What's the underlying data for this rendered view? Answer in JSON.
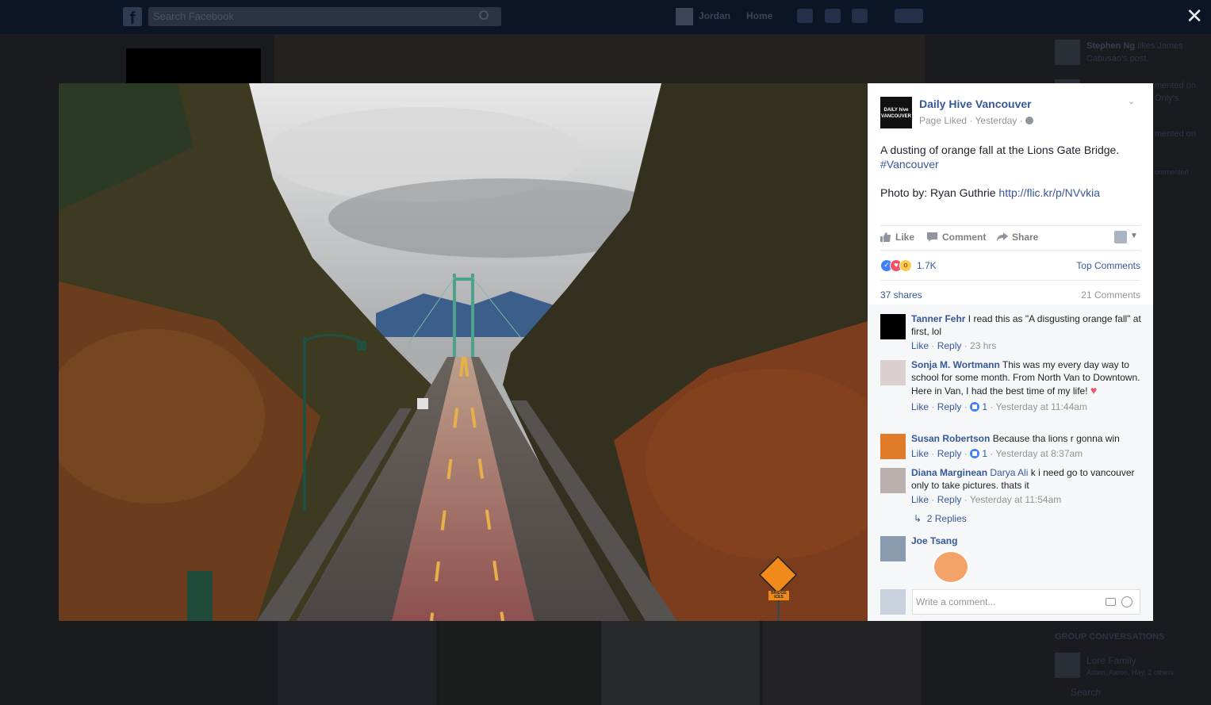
{
  "topbar": {
    "search_placeholder": "Search Facebook",
    "user_name": "Jordan",
    "home_label": "Home",
    "close_label": "✕"
  },
  "ticker": [
    {
      "name": "Stephen Ng",
      "text": "likes James Cabusao's post."
    },
    {
      "name": "",
      "text": "mented on Only's"
    },
    {
      "name": "",
      "text": "mented on"
    },
    {
      "name": "",
      "text": "ommented"
    }
  ],
  "sidebar_bottom": {
    "section_title": "GROUP CONVERSATIONS",
    "group_name": "Lore Family",
    "group_members": "Adam, Aaron, Hay, 2 others",
    "search_label": "Search"
  },
  "post": {
    "page_name": "Daily Hive Vancouver",
    "logo_text": "DAILY hive VANCOUVER",
    "meta": "Page Liked · Yesterday · ",
    "text_line1": "A dusting of orange fall at the Lions Gate Bridge.",
    "hashtag": "#Vancouver",
    "photo_credit": "Photo by: Ryan Guthrie ",
    "link": "http://flic.kr/p/NVvkia",
    "sign_text": "BRIDGE ICES"
  },
  "actions": {
    "like": "Like",
    "comment": "Comment",
    "share": "Share"
  },
  "stats": {
    "reaction_count": "1.7K",
    "top_comments": "Top Comments",
    "shares": "37 shares",
    "comments": "21 Comments"
  },
  "comments": [
    {
      "author": "Tanner Fehr",
      "text": " I read this as \"A disgusting orange fall\" at first, lol",
      "like": "Like",
      "reply": "Reply",
      "likes": "",
      "time": "23 hrs"
    },
    {
      "author": "Sonja M. Wortmann",
      "text": " This was my every day way to school for some month. From North Van to Downtown. Here in Van, I had the best time of my life! ",
      "like": "Like",
      "reply": "Reply",
      "likes": "1",
      "time": "Yesterday at 11:44am"
    },
    {
      "author": "Susan Robertson",
      "text": " Because tha lions r gonna win",
      "like": "Like",
      "reply": "Reply",
      "likes": "1",
      "time": "Yesterday at 8:37am"
    },
    {
      "author": "Diana Marginean",
      "mention": "Darya Ali",
      "text": " k i need go to vancouver only to take pictures. thats it",
      "like": "Like",
      "reply": "Reply",
      "likes": "",
      "time": "Yesterday at 11:54am"
    },
    {
      "author": "Joe Tsang",
      "text": ""
    }
  ],
  "replies_link": "2 Replies",
  "write_placeholder": "Write a comment...",
  "colors": {
    "link_blue": "#365899",
    "like_blue": "#4080ff",
    "love_red": "#f25268",
    "wow_yellow": "#fcc94b",
    "overlay": "#1a1b1e"
  }
}
